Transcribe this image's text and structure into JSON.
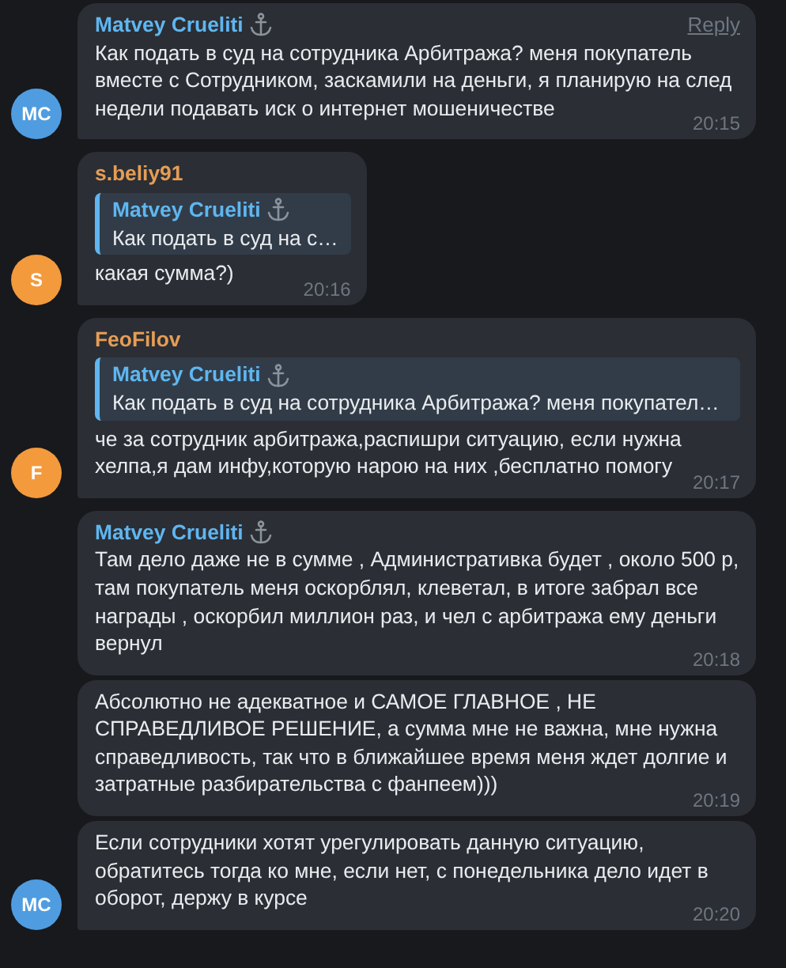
{
  "messages": [
    {
      "author": "Matvey Crueliti",
      "color": "#5fb6f0",
      "anchor": true,
      "reply_button": "Reply",
      "text": "Как подать в суд на сотрудника Арбитража? меня покупатель вместе с Сотрудником, заскамили на деньги, я планирую на след недели подавать иск о интернет мошеничестве",
      "time": "20:15",
      "avatar": {
        "initials": "MC",
        "color": "#4f9de0"
      }
    },
    {
      "author": "s.beliy91",
      "color": "#e59d55",
      "reply": {
        "author": "Matvey Crueliti",
        "anchor": true,
        "text": "Как подать в суд на с…"
      },
      "text": "какая сумма?)",
      "time": "20:16",
      "avatar": {
        "initials": "S",
        "color": "#f39a3c"
      }
    },
    {
      "author": "FeoFilov",
      "color": "#e59d55",
      "reply": {
        "author": "Matvey Crueliti",
        "anchor": true,
        "text": "Как подать в суд на сотрудника Арбитража? меня покупател…"
      },
      "text": "че за сотрудник арбитража,распишри ситуацию, если нужна хелпа,я дам инфу,которую нарою на них ,бесплатно помогу",
      "time": "20:17",
      "avatar": {
        "initials": "F",
        "color": "#f39a3c"
      }
    },
    {
      "author": "Matvey Crueliti",
      "color": "#5fb6f0",
      "anchor": true,
      "text": "Там дело даже не в сумме , Административка будет , около 500 р, там покупатель меня оскорблял, клеветал, в итоге забрал все награды , оскорбил миллион раз, и чел с арбитража ему деньги вернул",
      "time": "20:18"
    },
    {
      "text": "Абсолютно не адекватное и САМОЕ ГЛАВНОЕ , НЕ СПРАВЕДЛИВОЕ РЕШЕНИЕ, а сумма мне не важна, мне нужна справедливость, так что в ближайшее время меня ждет долгие и затратные разбирательства с фанпеем)))",
      "time": "20:19"
    },
    {
      "text": "Если сотрудники хотят урегулировать данную ситуацию, обратитесь тогда ко мне, если нет, с понедельника дело идет в оборот, держу в курсе",
      "time": "20:20",
      "avatar": {
        "initials": "MC",
        "color": "#4f9de0"
      }
    }
  ]
}
